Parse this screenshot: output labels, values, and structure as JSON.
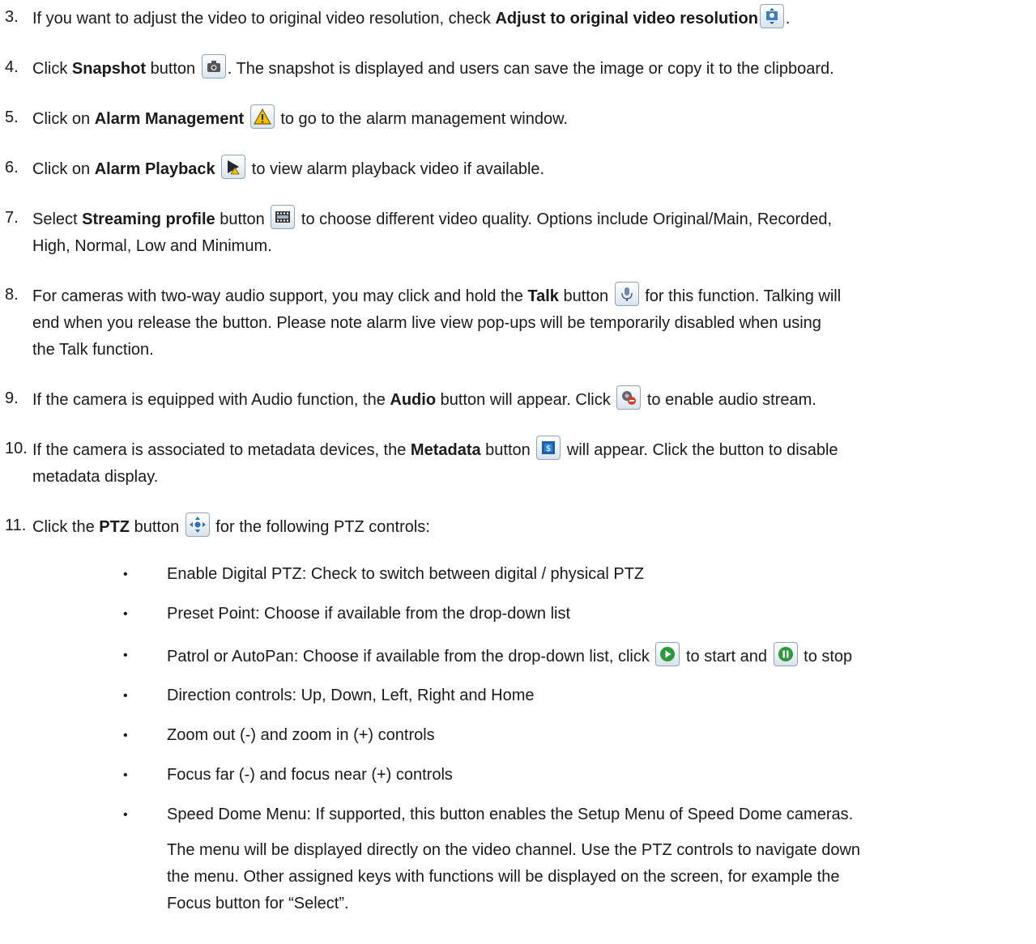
{
  "steps": [
    {
      "num": "3.",
      "pre": "If you want to adjust the video to original video resolution, check ",
      "bold": "Adjust to original video resolution",
      "mid": "",
      "icon": "adjust-resolution-icon",
      "post": "."
    },
    {
      "num": "4.",
      "pre": "Click ",
      "bold": "Snapshot",
      "mid": " button ",
      "icon": "camera-icon",
      "post": ". The snapshot is displayed and users can save the image or copy it to the clipboard."
    },
    {
      "num": "5.",
      "pre": "Click on ",
      "bold": "Alarm Management",
      "mid": " ",
      "icon": "alarm-warning-icon",
      "post": " to go to the alarm management window."
    },
    {
      "num": "6.",
      "pre": "Click on ",
      "bold": "Alarm Playback",
      "mid": " ",
      "icon": "alarm-playback-icon",
      "post": " to view alarm playback video if available."
    },
    {
      "num": "7.",
      "pre": "Select ",
      "bold": "Streaming profile",
      "mid": " button ",
      "icon": "film-strip-icon",
      "post": " to choose different video quality.  Options include Original/Main, Recorded,",
      "cont": "High, Normal, Low and Minimum."
    },
    {
      "num": "8.",
      "pre": "For cameras with two-way audio support, you may click and hold the ",
      "bold": "Talk",
      "mid": " button ",
      "icon": "microphone-icon",
      "post": " for this function.  Talking will",
      "cont": "end when you release the button.  Please note alarm live view pop-ups will be temporarily disabled when using",
      "cont2": "the Talk function."
    },
    {
      "num": "9.",
      "pre": "If the camera is equipped with Audio function, the ",
      "bold": "Audio",
      "mid": " button will appear. Click ",
      "icon": "audio-icon",
      "post": " to enable audio stream."
    },
    {
      "num": "10.",
      "pre": "If the camera is associated to metadata devices, the ",
      "bold": "Metadata",
      "mid": " button ",
      "icon": "metadata-icon",
      "post": " will appear. Click the button to disable",
      "cont": "metadata display."
    },
    {
      "num": "11.",
      "pre": "Click the ",
      "bold": "PTZ",
      "mid": " button ",
      "icon": "ptz-icon",
      "post": " for the following PTZ controls:"
    }
  ],
  "bullets": [
    {
      "text": "Enable Digital PTZ: Check to switch between digital / physical PTZ"
    },
    {
      "text": "Preset Point: Choose if available from the drop-down list"
    },
    {
      "pre": "Patrol or AutoPan: Choose if available from the drop-down list, click ",
      "icon1": "play-icon",
      "mid": " to start and ",
      "icon2": "pause-icon",
      "post": " to stop"
    },
    {
      "text": "Direction controls: Up, Down, Left, Right and Home"
    },
    {
      "text": "Zoom out (-) and zoom in (+) controls"
    },
    {
      "text": "Focus far (-) and focus near (+) controls"
    },
    {
      "text": "Speed Dome Menu: If supported, this button enables the Setup Menu of Speed Dome cameras."
    }
  ],
  "bullet_glyph": "•",
  "speed_dome_note": [
    "The menu will be displayed directly on the video channel.  Use the PTZ controls to navigate down",
    "the menu.  Other assigned keys with functions will be displayed on the screen, for example the",
    "Focus button for “Select”."
  ]
}
